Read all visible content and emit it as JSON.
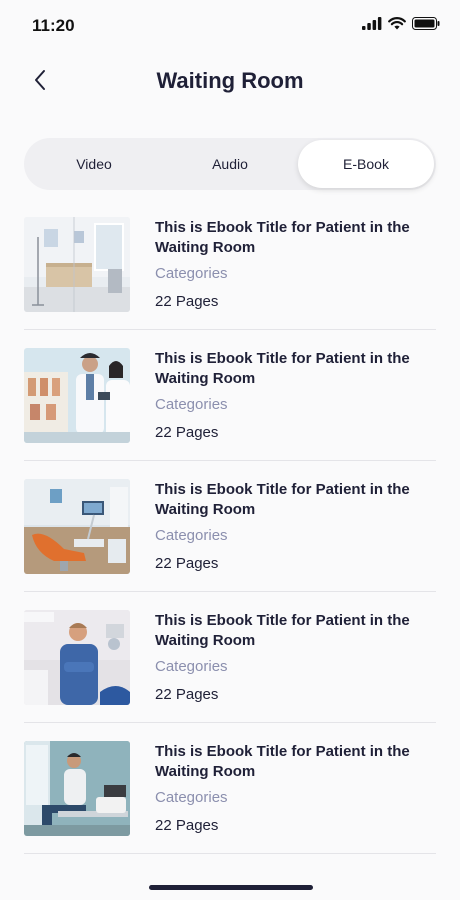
{
  "status_bar": {
    "time": "11:20"
  },
  "header": {
    "title": "Waiting Room"
  },
  "tabs": [
    {
      "label": "Video",
      "active": false
    },
    {
      "label": "Audio",
      "active": false
    },
    {
      "label": "E-Book",
      "active": true
    }
  ],
  "ebooks": [
    {
      "title": "This is Ebook Title for Patient in the Waiting Room",
      "category": "Categories",
      "pages": "22 Pages"
    },
    {
      "title": "This is Ebook Title for Patient in the Waiting Room",
      "category": "Categories",
      "pages": "22 Pages"
    },
    {
      "title": "This is Ebook Title for Patient in the Waiting Room",
      "category": "Categories",
      "pages": "22 Pages"
    },
    {
      "title": "This is Ebook Title for Patient in the Waiting Room",
      "category": "Categories",
      "pages": "22 Pages"
    },
    {
      "title": "This is Ebook Title for Patient in the Waiting Room",
      "category": "Categories",
      "pages": "22 Pages"
    }
  ],
  "icons": {
    "back": "chevron-left-icon",
    "signal": "cellular-signal-icon",
    "wifi": "wifi-icon",
    "battery": "battery-icon"
  },
  "colors": {
    "text_primary": "#1f2037",
    "text_muted": "#8b8fae",
    "segment_bg": "#efeff2",
    "active_tab_bg": "#ffffff"
  }
}
